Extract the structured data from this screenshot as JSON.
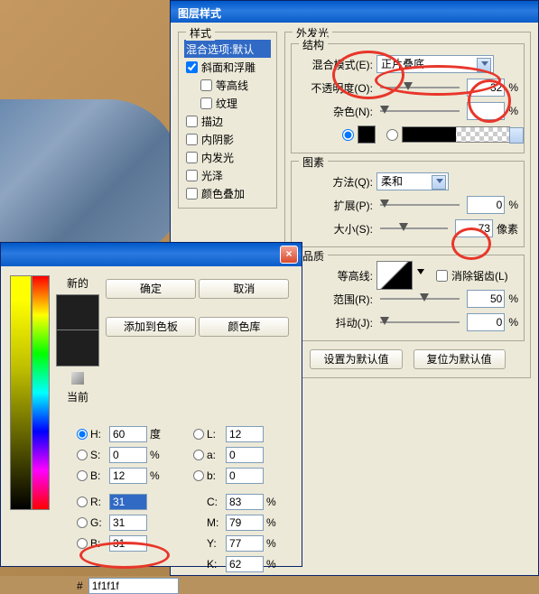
{
  "layerStyle": {
    "title": "图层样式",
    "stylesHeader": "样式",
    "blendOptions": "混合选项:默认",
    "items": [
      {
        "label": "斜面和浮雕",
        "checked": true
      },
      {
        "label": "等高线",
        "checked": false
      },
      {
        "label": "纹理",
        "checked": false
      },
      {
        "label": "描边",
        "checked": false
      },
      {
        "label": "内阴影",
        "checked": false
      },
      {
        "label": "内发光",
        "checked": false
      },
      {
        "label": "光泽",
        "checked": false
      },
      {
        "label": "颜色叠加",
        "checked": false
      }
    ],
    "outerGlow": {
      "title": "外发光",
      "structure": "结构",
      "blendModeLabel": "混合模式(E):",
      "blendMode": "正片叠底",
      "opacityLabel": "不透明度(O):",
      "opacity": "32",
      "noiseLabel": "杂色(N):",
      "noise": "",
      "elements": "图素",
      "techniqueLabel": "方法(Q):",
      "technique": "柔和",
      "spreadLabel": "扩展(P):",
      "spread": "0",
      "sizeLabel": "大小(S):",
      "size": "73",
      "sizeUnit": "像素",
      "quality": "品质",
      "contourLabel": "等高线:",
      "antiAlias": "消除锯齿(L)",
      "rangeLabel": "范围(R):",
      "range": "50",
      "jitterLabel": "抖动(J):",
      "jitter": "0",
      "pct": "%",
      "setDefault": "设置为默认值",
      "resetDefault": "复位为默认值"
    }
  },
  "colorPicker": {
    "newLabel": "新的",
    "curLabel": "当前",
    "ok": "确定",
    "cancel": "取消",
    "addSwatch": "添加到色板",
    "colorLib": "颜色库",
    "H": "60",
    "Hdeg": "度",
    "S": "0",
    "Bv": "12",
    "R": "31",
    "G": "31",
    "Bc": "31",
    "L": "12",
    "a": "0",
    "b": "0",
    "C": "83",
    "M": "79",
    "Y": "77",
    "K": "62",
    "hex": "1f1f1f",
    "pct": "%",
    "labels": {
      "H": "H:",
      "S": "S:",
      "B": "B:",
      "R": "R:",
      "G": "G:",
      "Bc": "B:",
      "L": "L:",
      "a": "a:",
      "b": "b:",
      "C": "C:",
      "M": "M:",
      "Y": "Y:",
      "K": "K:",
      "hash": "#"
    }
  }
}
